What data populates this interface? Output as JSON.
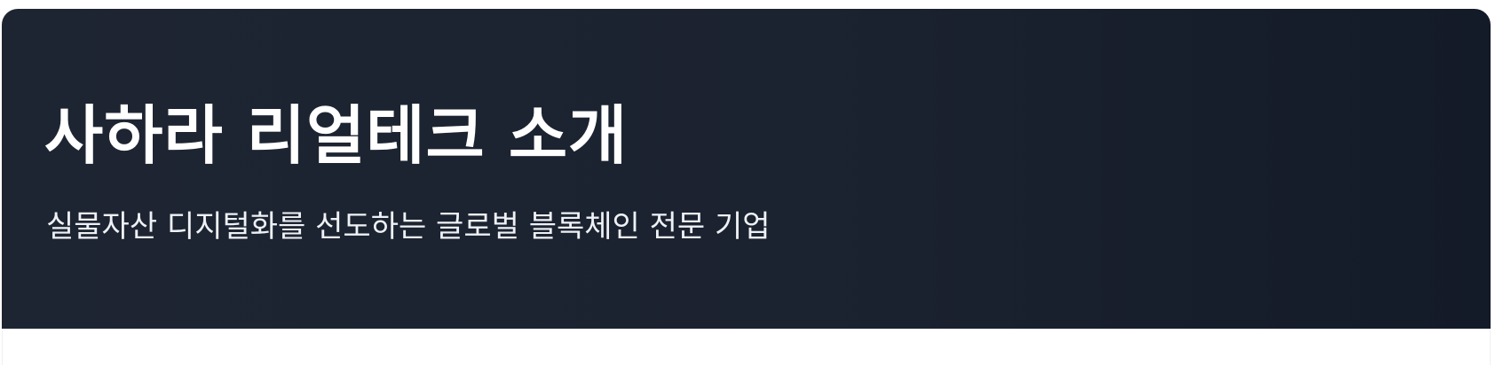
{
  "hero": {
    "title": "사하라 리얼테크 소개",
    "subtitle": "실물자산 디지털화를 선도하는 글로벌 블록체인 전문 기업"
  },
  "colors": {
    "hero_background_start": "#1e2532",
    "hero_background_end": "#131a28",
    "title_text": "#ffffff",
    "subtitle_text": "#eef1f5",
    "page_background": "#ffffff"
  }
}
